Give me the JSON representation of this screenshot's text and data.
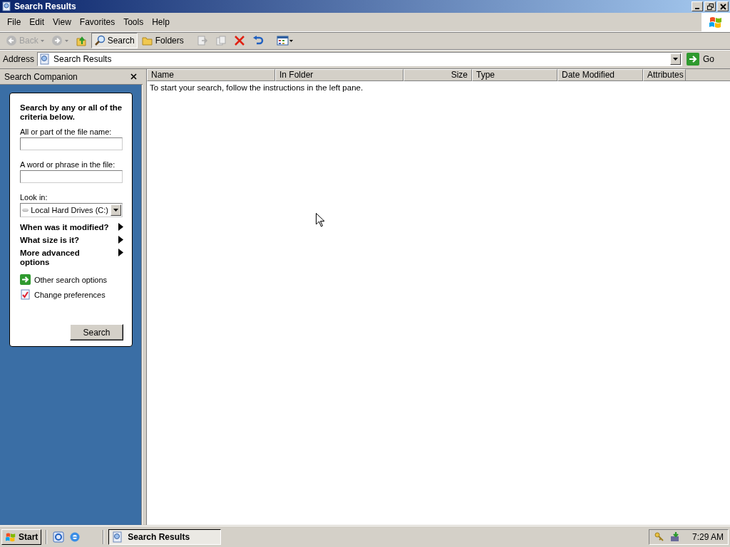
{
  "window": {
    "title": "Search Results"
  },
  "menu": [
    "File",
    "Edit",
    "View",
    "Favorites",
    "Tools",
    "Help"
  ],
  "toolbar": [
    {
      "kind": "back",
      "label": "Back",
      "disabled": true
    },
    {
      "kind": "forward",
      "disabled": true
    },
    {
      "kind": "up",
      "disabled": false
    },
    {
      "kind": "search",
      "label": "Search",
      "selected": true
    },
    {
      "kind": "folders",
      "label": "Folders",
      "selected": false
    },
    {
      "kind": "move",
      "disabled": true
    },
    {
      "kind": "copy",
      "disabled": true
    },
    {
      "kind": "delete",
      "disabled": false
    },
    {
      "kind": "undo",
      "disabled": false
    },
    {
      "kind": "views",
      "disabled": false
    }
  ],
  "address": {
    "label": "Address",
    "value": "Search Results",
    "go": "Go"
  },
  "search_companion": {
    "title": "Search Companion",
    "heading": "Search by any or all of the criteria below.",
    "fields": [
      {
        "label": "All or part of the file name:"
      },
      {
        "label": "A word or phrase in the file:"
      }
    ],
    "look_in": {
      "label": "Look in:",
      "value": "Local Hard Drives (C:)"
    },
    "sections": [
      {
        "label": "When was it modified?",
        "expanded": false
      },
      {
        "label": "What size is it?",
        "expanded": false
      },
      {
        "label": "More advanced options",
        "expanded": false
      }
    ],
    "links": [
      {
        "kind": "other",
        "label": "Other search options"
      },
      {
        "kind": "prefs",
        "label": "Change preferences"
      }
    ],
    "button": "Search"
  },
  "table": {
    "columns": [
      "Name",
      "In Folder",
      "Size",
      "Type",
      "Date Modified",
      "Attributes"
    ],
    "message": "To start your search, follow the instructions in the left pane."
  },
  "taskbar": {
    "start": "Start",
    "tasks": [
      {
        "label": "Search Results",
        "selected": true
      }
    ],
    "clock": "7:29 AM"
  }
}
